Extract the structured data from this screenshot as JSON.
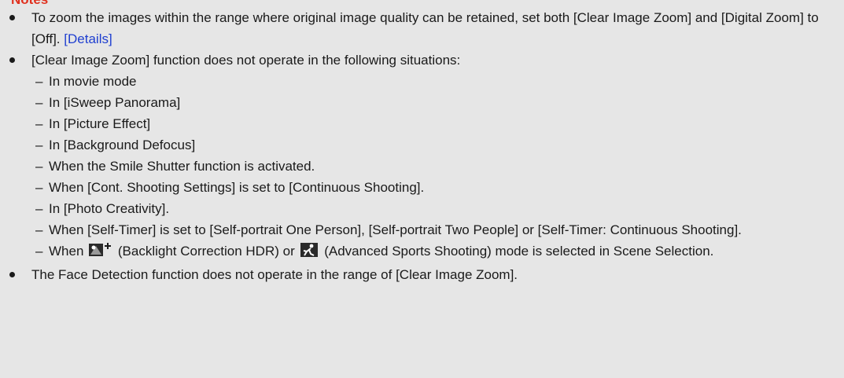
{
  "heading": "Notes",
  "notes": {
    "bullet1_text": "To zoom the images within the range where original image quality can be retained, set both [Clear Image Zoom] and [Digital Zoom] to [Off].",
    "bullet1_link": "[Details]",
    "bullet2_text": "[Clear Image Zoom] function does not operate in the following situations:",
    "sub_items": [
      "In movie mode",
      "In [iSweep Panorama]",
      "In [Picture Effect]",
      "In [Background Defocus]",
      "When the Smile Shutter function is activated.",
      "When [Cont. Shooting Settings] is set to [Continuous Shooting].",
      "In [Photo Creativity].",
      "When [Self-Timer] is set to [Self-portrait One Person], [Self-portrait Two People] or [Self-Timer: Continuous Shooting]."
    ],
    "sub_last": {
      "prefix": "When",
      "icon1": "backlight-correction-hdr-icon",
      "mid": "(Backlight Correction HDR) or",
      "icon2": "advanced-sports-shooting-icon",
      "suffix": "(Advanced Sports Shooting) mode is selected in Scene Selection."
    },
    "bullet3_text": "The Face Detection function does not operate in the range of [Clear Image Zoom].",
    "dash": "–"
  },
  "colors": {
    "heading": "#e0301e",
    "link": "#1f3fd0",
    "background": "#e6e6e6"
  }
}
